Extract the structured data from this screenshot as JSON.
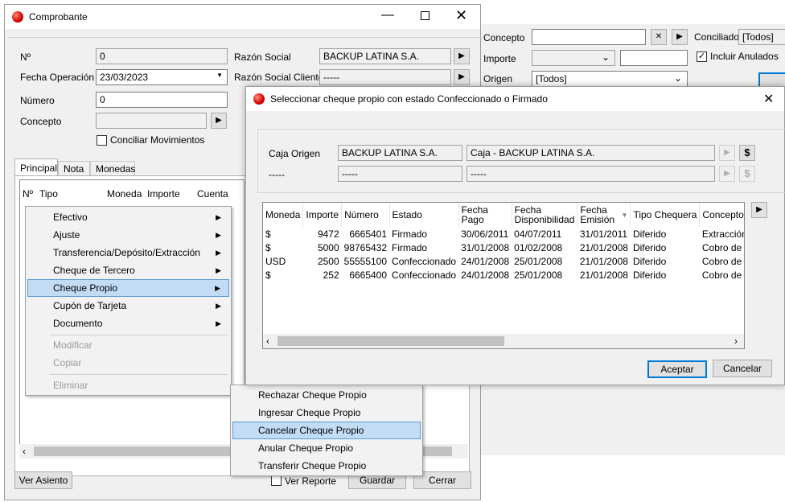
{
  "bg": {
    "concepto_label": "Concepto",
    "importe_label": "Importe",
    "origen_label": "Origen",
    "origen_value": "[Todos]",
    "conciliado_label": "Conciliado",
    "conciliado_value": "[Todos]",
    "incluir_anulados_label": "Incluir Anulados",
    "clear_symbol": "✕",
    "play_symbol": "▶"
  },
  "comprobante": {
    "title": "Comprobante",
    "fields": {
      "nro_label": "Nº",
      "nro_value": "0",
      "fecha_label": "Fecha Operación",
      "fecha_value": "23/03/2023",
      "numero_label": "Número",
      "numero_value": "0",
      "concepto_label": "Concepto",
      "concepto_value": "",
      "conciliar_label": "Conciliar Movimientos",
      "razon_social_label": "Razón Social",
      "razon_social_value": "BACKUP LATINA S.A.",
      "razon_social_cliente_label": "Razón Social Cliente",
      "razon_social_cliente_value": "-----"
    },
    "tabs": [
      "Principal",
      "Nota",
      "Monedas"
    ],
    "grid_headers": [
      "Nº",
      "Tipo",
      "Moneda",
      "Importe",
      "Cuenta"
    ],
    "buttons": {
      "ver_asiento": "Ver Asiento",
      "ver_reporte": "Ver Reporte",
      "guardar": "Guardar",
      "cerrar": "Cerrar"
    }
  },
  "context_menu": {
    "items": [
      {
        "label": "Efectivo",
        "submenu": true
      },
      {
        "label": "Ajuste",
        "submenu": true
      },
      {
        "label": "Transferencia/Depósito/Extracción",
        "submenu": true
      },
      {
        "label": "Cheque de Tercero",
        "submenu": true
      },
      {
        "label": "Cheque Propio",
        "submenu": true,
        "selected": true
      },
      {
        "label": "Cupón de Tarjeta",
        "submenu": true
      },
      {
        "label": "Documento",
        "submenu": true
      }
    ],
    "disabled_items": [
      "Modificar",
      "Copiar",
      "Eliminar"
    ]
  },
  "submenu": {
    "items": [
      "Rechazar Cheque Propio",
      "Ingresar Cheque Propio",
      "Cancelar Cheque Propio",
      "Anular Cheque Propio",
      "Transferir Cheque Propio"
    ],
    "selected_index": 2
  },
  "dialog": {
    "title": "Seleccionar cheque propio con estado Confeccionado o Firmado",
    "caja_origen_label": "Caja Origen",
    "caja_origen_value1": "BACKUP LATINA S.A.",
    "caja_origen_value2": "Caja - BACKUP LATINA S.A.",
    "row2_label": "-----",
    "row2_value1": "-----",
    "row2_value2": "-----",
    "dollar_symbol": "$",
    "columns": [
      "Moneda",
      "Importe",
      "Número",
      "Estado",
      "Fecha Pago",
      "Fecha Disponibilidad",
      "Fecha Emisión",
      "Tipo Chequera",
      "Concepto"
    ],
    "rows": [
      [
        "$",
        "9472",
        "6665401",
        "Firmado",
        "30/06/2011",
        "04/07/2011",
        "31/01/2011",
        "Diferido",
        "Extracción d"
      ],
      [
        "$",
        "5000",
        "98765432",
        "Firmado",
        "31/01/2008",
        "01/02/2008",
        "21/01/2008",
        "Diferido",
        "Cobro de Ch"
      ],
      [
        "USD",
        "2500",
        "55555100",
        "Confeccionado",
        "24/01/2008",
        "25/01/2008",
        "21/01/2008",
        "Diferido",
        "Cobro de Ch"
      ],
      [
        "$",
        "252",
        "6665400",
        "Confeccionado",
        "24/01/2008",
        "25/01/2008",
        "21/01/2008",
        "Diferido",
        "Cobro de Ch"
      ]
    ],
    "aceptar": "Aceptar",
    "cancelar": "Cancelar"
  }
}
